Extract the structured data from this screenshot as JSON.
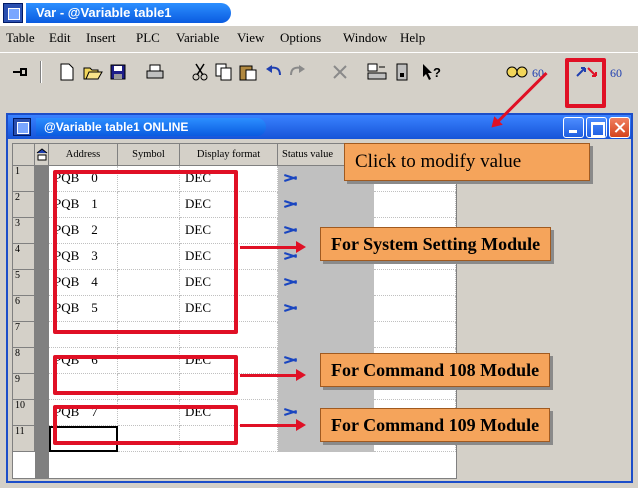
{
  "app": {
    "window_title": "Var - @Variable table1"
  },
  "menu": {
    "items": [
      "Table",
      "Edit",
      "Insert",
      "PLC",
      "Variable",
      "View",
      "Options",
      "Window",
      "Help"
    ]
  },
  "toolbar": {
    "buttons": [
      "pin-icon",
      "new-icon",
      "open-icon",
      "save-icon",
      "print-icon",
      "cut-icon",
      "copy-icon",
      "paste-icon",
      "undo-icon",
      "redo-icon",
      "delete-icon",
      "network-icon",
      "download-icon",
      "whats-this-icon",
      "monitor-icon",
      "modify-value-icon",
      "force-icon"
    ]
  },
  "table_window": {
    "title": "@Variable table1  ONLINE",
    "columns": [
      "Address",
      "Symbol",
      "Display format",
      "Status value"
    ],
    "rows": [
      {
        "num": "1",
        "address": "PQB",
        "index": "0",
        "format": "DEC",
        "has_status": true
      },
      {
        "num": "2",
        "address": "PQB",
        "index": "1",
        "format": "DEC",
        "has_status": true
      },
      {
        "num": "3",
        "address": "PQB",
        "index": "2",
        "format": "DEC",
        "has_status": true
      },
      {
        "num": "4",
        "address": "PQB",
        "index": "3",
        "format": "DEC",
        "has_status": true
      },
      {
        "num": "5",
        "address": "PQB",
        "index": "4",
        "format": "DEC",
        "has_status": true
      },
      {
        "num": "6",
        "address": "PQB",
        "index": "5",
        "format": "DEC",
        "has_status": true
      },
      {
        "num": "7",
        "address": "",
        "index": "",
        "format": "",
        "has_status": false
      },
      {
        "num": "8",
        "address": "PQB",
        "index": "6",
        "format": "DEC",
        "has_status": true
      },
      {
        "num": "9",
        "address": "",
        "index": "",
        "format": "",
        "has_status": false
      },
      {
        "num": "10",
        "address": "PQB",
        "index": "7",
        "format": "DEC",
        "has_status": true
      },
      {
        "num": "11",
        "address": "",
        "index": "",
        "format": "",
        "has_status": false
      }
    ]
  },
  "annotations": {
    "modify_tip": "Click to modify value",
    "system_setting": "For System Setting Module",
    "command_108": "For Command 108 Module",
    "command_109": "For Command 109 Module"
  },
  "colors": {
    "annotation_red": "#e01025",
    "callout_orange": "#f5a45b",
    "title_blue": "#1654d8"
  }
}
